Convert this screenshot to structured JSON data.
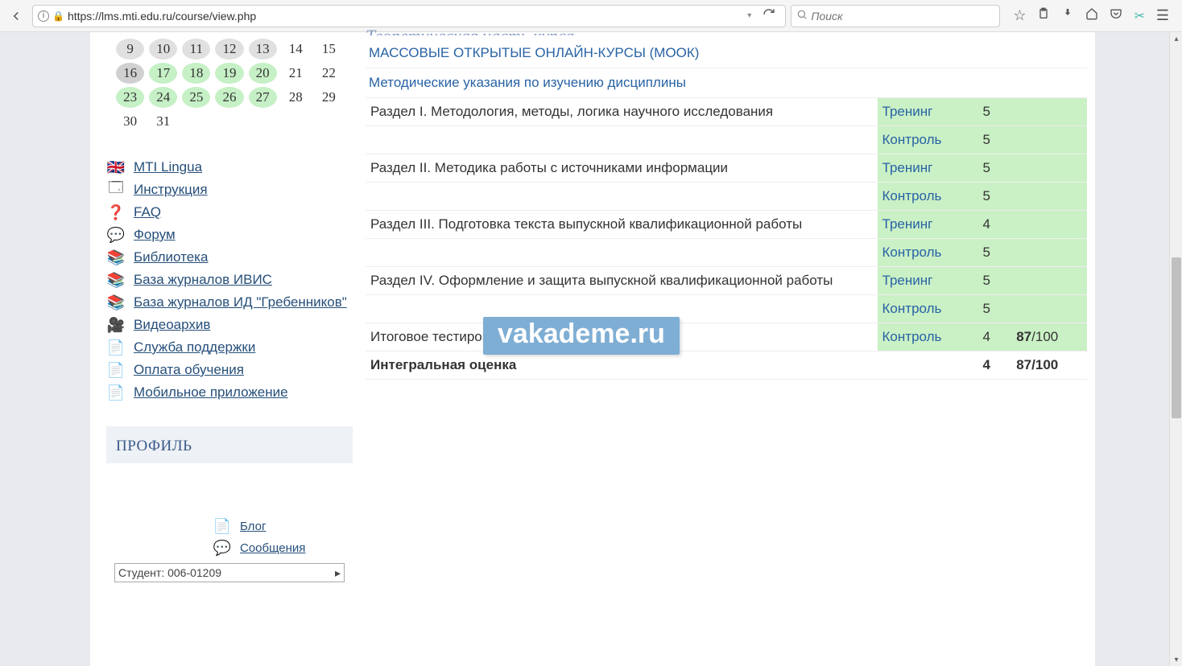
{
  "browser": {
    "url": "https://lms.mti.edu.ru/course/view.php",
    "search_placeholder": "Поиск"
  },
  "calendar": {
    "rows": [
      [
        {
          "d": "9",
          "c": "hl-grey"
        },
        {
          "d": "10",
          "c": "hl-grey"
        },
        {
          "d": "11",
          "c": "hl-grey"
        },
        {
          "d": "12",
          "c": "hl-grey"
        },
        {
          "d": "13",
          "c": "hl-grey"
        },
        {
          "d": "14",
          "c": ""
        },
        {
          "d": "15",
          "c": ""
        }
      ],
      [
        {
          "d": "16",
          "c": "hl-dark"
        },
        {
          "d": "17",
          "c": "hl-green"
        },
        {
          "d": "18",
          "c": "hl-green"
        },
        {
          "d": "19",
          "c": "hl-green"
        },
        {
          "d": "20",
          "c": "hl-green"
        },
        {
          "d": "21",
          "c": ""
        },
        {
          "d": "22",
          "c": ""
        }
      ],
      [
        {
          "d": "23",
          "c": "hl-green"
        },
        {
          "d": "24",
          "c": "hl-green"
        },
        {
          "d": "25",
          "c": "hl-green"
        },
        {
          "d": "26",
          "c": "hl-green"
        },
        {
          "d": "27",
          "c": "hl-green"
        },
        {
          "d": "28",
          "c": ""
        },
        {
          "d": "29",
          "c": ""
        }
      ],
      [
        {
          "d": "30",
          "c": ""
        },
        {
          "d": "31",
          "c": ""
        },
        {
          "d": "",
          "c": ""
        },
        {
          "d": "",
          "c": ""
        },
        {
          "d": "",
          "c": ""
        },
        {
          "d": "",
          "c": ""
        },
        {
          "d": "",
          "c": ""
        }
      ]
    ]
  },
  "sidebar_links": [
    {
      "icon": "flag",
      "label": "MTI Lingua"
    },
    {
      "icon": "window",
      "label": "Инструкция"
    },
    {
      "icon": "question",
      "label": "FAQ"
    },
    {
      "icon": "chat",
      "label": "Форум"
    },
    {
      "icon": "books",
      "label": "Библиотека"
    },
    {
      "icon": "books",
      "label": "База журналов ИВИС"
    },
    {
      "icon": "books",
      "label": "База журналов ИД \"Гребенников\""
    },
    {
      "icon": "camera",
      "label": "Видеоархив"
    },
    {
      "icon": "doc",
      "label": "Служба поддержки"
    },
    {
      "icon": "doc",
      "label": "Оплата обучения"
    },
    {
      "icon": "doc",
      "label": "Мобильное приложение"
    }
  ],
  "profile": {
    "title": "ПРОФИЛЬ",
    "links": [
      {
        "icon": "doc",
        "label": "Блог"
      },
      {
        "icon": "chat",
        "label": "Сообщения"
      }
    ],
    "student_select": "Студент: 006-01209"
  },
  "main": {
    "header_partial": "Теоретическая часть курса",
    "mooc_link": "МАССОВЫЕ ОТКРЫТЫЕ ОНЛАЙН-КУРСЫ (МООК)",
    "method_link": "Методические указания по изучению дисциплины",
    "sections": [
      {
        "name": "Раздел I. Методология, методы, логика научного исследования",
        "rows": [
          {
            "t": "Тренинг",
            "s": "5",
            "g": ""
          },
          {
            "t": "Контроль",
            "s": "5",
            "g": ""
          }
        ]
      },
      {
        "name": "Раздел II. Методика работы с источниками информации",
        "rows": [
          {
            "t": "Тренинг",
            "s": "5",
            "g": ""
          },
          {
            "t": "Контроль",
            "s": "5",
            "g": ""
          }
        ]
      },
      {
        "name": "Раздел III. Подготовка текста выпускной квалификационной работы",
        "rows": [
          {
            "t": "Тренинг",
            "s": "4",
            "g": ""
          },
          {
            "t": "Контроль",
            "s": "5",
            "g": ""
          }
        ]
      },
      {
        "name": "Раздел IV. Оформление и защита выпускной квалификационной работы",
        "rows": [
          {
            "t": "Тренинг",
            "s": "5",
            "g": ""
          },
          {
            "t": "Контроль",
            "s": "5",
            "g": ""
          }
        ]
      }
    ],
    "final_test": {
      "name": "Итоговое тестирование",
      "t": "Контроль",
      "s": "4",
      "g_num": "87",
      "g_den": "/100"
    },
    "integral": {
      "name": "Интегральная оценка",
      "s": "4",
      "g_num": "87",
      "g_den": "/100"
    }
  },
  "watermark": "vakademe.ru"
}
